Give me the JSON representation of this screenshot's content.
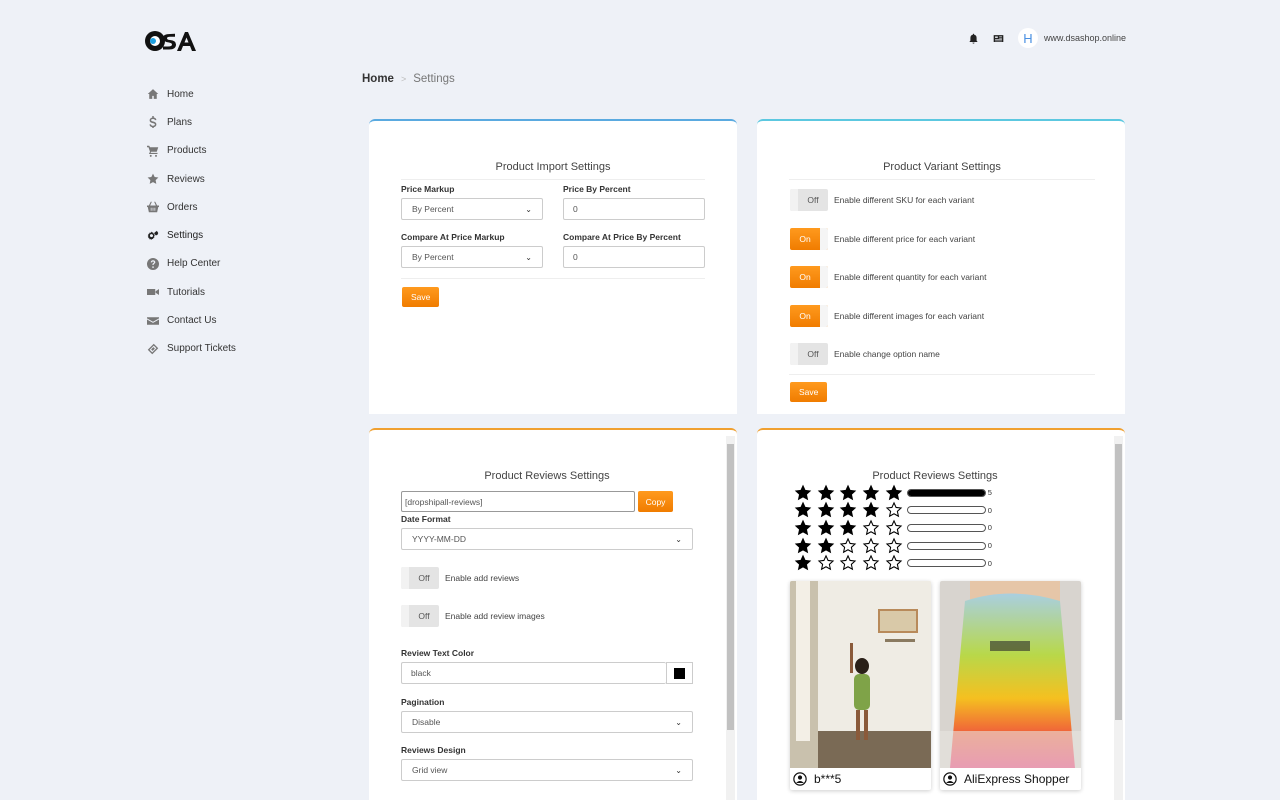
{
  "brand": {
    "logo_text": "DSA"
  },
  "topbar": {
    "avatar_letter": "H",
    "shop_url": "www.dsashop.online"
  },
  "sidebar": {
    "items": [
      {
        "label": "Home",
        "icon": "home-icon"
      },
      {
        "label": "Plans",
        "icon": "dollar-icon"
      },
      {
        "label": "Products",
        "icon": "cart-icon"
      },
      {
        "label": "Reviews",
        "icon": "star-icon"
      },
      {
        "label": "Orders",
        "icon": "basket-icon"
      },
      {
        "label": "Settings",
        "icon": "gears-icon"
      },
      {
        "label": "Help Center",
        "icon": "question-icon"
      },
      {
        "label": "Tutorials",
        "icon": "video-icon"
      },
      {
        "label": "Contact Us",
        "icon": "envelope-icon"
      },
      {
        "label": "Support Tickets",
        "icon": "ticket-icon"
      }
    ]
  },
  "breadcrumb": {
    "home": "Home",
    "separator": ">",
    "current": "Settings"
  },
  "import_settings": {
    "title": "Product Import Settings",
    "price_markup_label": "Price Markup",
    "price_markup_value": "By Percent",
    "price_by_percent_label": "Price By Percent",
    "price_by_percent_value": "0",
    "compare_markup_label": "Compare At Price Markup",
    "compare_markup_value": "By Percent",
    "compare_by_percent_label": "Compare At Price By Percent",
    "compare_by_percent_value": "0",
    "save_label": "Save"
  },
  "variant_settings": {
    "title": "Product Variant Settings",
    "toggles": [
      {
        "state": "Off",
        "label": "Enable different SKU for each variant"
      },
      {
        "state": "On",
        "label": "Enable different price for each variant"
      },
      {
        "state": "On",
        "label": "Enable different quantity for each variant"
      },
      {
        "state": "On",
        "label": "Enable different images for each variant"
      },
      {
        "state": "Off",
        "label": "Enable change option name"
      }
    ],
    "save_label": "Save"
  },
  "reviews_settings": {
    "title": "Product Reviews Settings",
    "shortcode_value": "[dropshipall-reviews]",
    "copy_label": "Copy",
    "date_format_label": "Date Format",
    "date_format_value": "YYYY-MM-DD",
    "add_reviews_state": "Off",
    "add_reviews_label": "Enable add reviews",
    "add_review_images_state": "Off",
    "add_review_images_label": "Enable add review images",
    "text_color_label": "Review Text Color",
    "text_color_value": "black",
    "text_color_swatch": "#000000",
    "pagination_label": "Pagination",
    "pagination_value": "Disable",
    "design_label": "Reviews Design",
    "design_value": "Grid view"
  },
  "reviews_preview": {
    "title": "Product Reviews Settings",
    "ratings": [
      {
        "stars": 5,
        "fill_fraction": 1.0,
        "count": "5"
      },
      {
        "stars": 4,
        "fill_fraction": 0,
        "count": "0"
      },
      {
        "stars": 3,
        "fill_fraction": 0,
        "count": "0"
      },
      {
        "stars": 2,
        "fill_fraction": 0,
        "count": "0"
      },
      {
        "stars": 1,
        "fill_fraction": 0,
        "count": "0"
      }
    ],
    "reviews": [
      {
        "user": "b***5"
      },
      {
        "user": "AliExpress Shopper"
      }
    ]
  },
  "colors": {
    "accent_orange": "#f5890c",
    "blue_border": "#5aaae0"
  }
}
